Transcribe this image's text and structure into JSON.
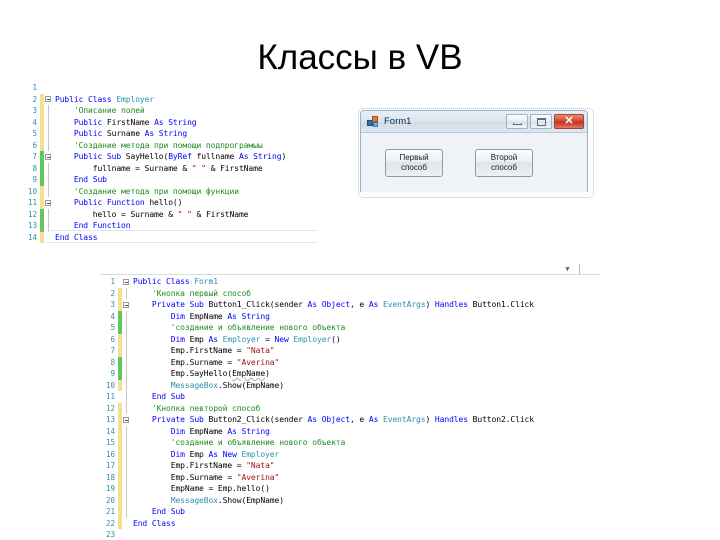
{
  "slide": {
    "title": "Классы в VB"
  },
  "code_panel_1": {
    "name": "Employer class code",
    "lines": [
      {
        "num": "1",
        "mark": "",
        "glyph": "",
        "indent": 0,
        "tokens": []
      },
      {
        "num": "2",
        "mark": "yellow",
        "glyph": "collapse",
        "indent": 0,
        "tokens": [
          {
            "t": "Public Class ",
            "c": "kw"
          },
          {
            "t": "Employer",
            "c": "typ"
          }
        ]
      },
      {
        "num": "3",
        "mark": "yellow",
        "glyph": "vbar",
        "indent": 4,
        "tokens": [
          {
            "t": "'Описание полей",
            "c": "cmt"
          }
        ]
      },
      {
        "num": "4",
        "mark": "yellow",
        "glyph": "vbar",
        "indent": 4,
        "tokens": [
          {
            "t": "Public ",
            "c": "kw"
          },
          {
            "t": "FirstName ",
            "c": "plain"
          },
          {
            "t": "As String",
            "c": "kw"
          }
        ]
      },
      {
        "num": "5",
        "mark": "yellow",
        "glyph": "vbar",
        "indent": 4,
        "tokens": [
          {
            "t": "Public ",
            "c": "kw"
          },
          {
            "t": "Surname ",
            "c": "plain"
          },
          {
            "t": "As String",
            "c": "kw"
          }
        ]
      },
      {
        "num": "6",
        "mark": "yellow",
        "glyph": "vbar",
        "indent": 4,
        "tokens": [
          {
            "t": "'Создание метода при помощи подпрограмыы",
            "c": "cmt"
          }
        ]
      },
      {
        "num": "7",
        "mark": "green",
        "glyph": "collapse",
        "indent": 4,
        "tokens": [
          {
            "t": "Public Sub ",
            "c": "kw"
          },
          {
            "t": "SayHello(",
            "c": "plain"
          },
          {
            "t": "ByRef ",
            "c": "kw"
          },
          {
            "t": "fullname ",
            "c": "plain"
          },
          {
            "t": "As String",
            "c": "kw"
          },
          {
            "t": ")",
            "c": "plain"
          }
        ]
      },
      {
        "num": "8",
        "mark": "green",
        "glyph": "vbar",
        "indent": 8,
        "tokens": [
          {
            "t": "fullname = Surname & ",
            "c": "plain"
          },
          {
            "t": "\" \"",
            "c": "str"
          },
          {
            "t": " & FirstName",
            "c": "plain"
          }
        ]
      },
      {
        "num": "9",
        "mark": "green",
        "glyph": "vbar",
        "indent": 4,
        "tokens": [
          {
            "t": "End Sub",
            "c": "kw"
          }
        ]
      },
      {
        "num": "10",
        "mark": "yellow",
        "glyph": "vbar",
        "indent": 4,
        "tokens": [
          {
            "t": "'Создание метода при помощи функции",
            "c": "cmt"
          }
        ]
      },
      {
        "num": "11",
        "mark": "yellow",
        "glyph": "collapse",
        "indent": 4,
        "tokens": [
          {
            "t": "Public Function ",
            "c": "kw"
          },
          {
            "t": "hello()",
            "c": "plain"
          }
        ]
      },
      {
        "num": "12",
        "mark": "green",
        "glyph": "vbar",
        "indent": 8,
        "tokens": [
          {
            "t": "hello = Surname & ",
            "c": "plain"
          },
          {
            "t": "\" \"",
            "c": "str"
          },
          {
            "t": " & FirstName",
            "c": "plain"
          }
        ]
      },
      {
        "num": "13",
        "mark": "green",
        "glyph": "vbar",
        "indent": 4,
        "tokens": [
          {
            "t": "End Function",
            "c": "kw"
          }
        ]
      },
      {
        "num": "14",
        "mark": "yellow",
        "glyph": "",
        "indent": 0,
        "tokens": [
          {
            "t": "End Class",
            "c": "kw"
          }
        ]
      }
    ]
  },
  "code_panel_2": {
    "name": "Form1 class code",
    "lines": [
      {
        "num": "1",
        "mark": "",
        "glyph": "collapse",
        "indent": 0,
        "tokens": [
          {
            "t": "Public Class ",
            "c": "kw"
          },
          {
            "t": "Form1",
            "c": "typ"
          }
        ]
      },
      {
        "num": "2",
        "mark": "yellow",
        "glyph": "vbar",
        "indent": 4,
        "tokens": [
          {
            "t": "'Кнопка первый способ",
            "c": "cmt"
          }
        ]
      },
      {
        "num": "3",
        "mark": "yellow",
        "glyph": "collapse",
        "indent": 4,
        "tokens": [
          {
            "t": "Private Sub ",
            "c": "kw"
          },
          {
            "t": "Button1_Click(sender ",
            "c": "plain"
          },
          {
            "t": "As ",
            "c": "kw"
          },
          {
            "t": "Object",
            "c": "kw"
          },
          {
            "t": ", e ",
            "c": "plain"
          },
          {
            "t": "As ",
            "c": "kw"
          },
          {
            "t": "EventArgs",
            "c": "typ"
          },
          {
            "t": ") ",
            "c": "plain"
          },
          {
            "t": "Handles ",
            "c": "kw"
          },
          {
            "t": "Button1.Click",
            "c": "plain"
          }
        ]
      },
      {
        "num": "4",
        "mark": "green",
        "glyph": "vbar",
        "indent": 8,
        "tokens": [
          {
            "t": "Dim ",
            "c": "kw"
          },
          {
            "t": "EmpName ",
            "c": "plain"
          },
          {
            "t": "As String",
            "c": "kw"
          }
        ]
      },
      {
        "num": "5",
        "mark": "green",
        "glyph": "vbar",
        "indent": 8,
        "tokens": [
          {
            "t": "'создание и объявление нового объекта",
            "c": "cmt"
          }
        ]
      },
      {
        "num": "6",
        "mark": "yellow",
        "glyph": "vbar",
        "indent": 8,
        "tokens": [
          {
            "t": "Dim ",
            "c": "kw"
          },
          {
            "t": "Emp ",
            "c": "plain"
          },
          {
            "t": "As ",
            "c": "kw"
          },
          {
            "t": "Employer ",
            "c": "typ"
          },
          {
            "t": "= ",
            "c": "plain"
          },
          {
            "t": "New ",
            "c": "kw"
          },
          {
            "t": "Employer",
            "c": "typ"
          },
          {
            "t": "()",
            "c": "plain"
          }
        ]
      },
      {
        "num": "7",
        "mark": "yellow",
        "glyph": "vbar",
        "indent": 8,
        "tokens": [
          {
            "t": "Emp.FirstName = ",
            "c": "plain"
          },
          {
            "t": "\"Nata\"",
            "c": "str"
          }
        ]
      },
      {
        "num": "8",
        "mark": "green",
        "glyph": "vbar",
        "indent": 8,
        "tokens": [
          {
            "t": "Emp.Surname = ",
            "c": "plain"
          },
          {
            "t": "\"Averina\"",
            "c": "str"
          }
        ]
      },
      {
        "num": "9",
        "mark": "green",
        "glyph": "vbar",
        "indent": 8,
        "tokens": [
          {
            "t": "Emp.SayHello(",
            "c": "plain"
          },
          {
            "t": "EmpName",
            "c": "sq"
          },
          {
            "t": ")",
            "c": "plain"
          }
        ]
      },
      {
        "num": "10",
        "mark": "yellow",
        "glyph": "vbar",
        "indent": 8,
        "tokens": [
          {
            "t": "MessageBox",
            "c": "typ"
          },
          {
            "t": ".Show(EmpName)",
            "c": "plain"
          }
        ]
      },
      {
        "num": "11",
        "mark": "",
        "glyph": "vbar",
        "indent": 4,
        "tokens": [
          {
            "t": "End Sub",
            "c": "kw"
          }
        ]
      },
      {
        "num": "12",
        "mark": "yellow",
        "glyph": "vbar",
        "indent": 4,
        "tokens": [
          {
            "t": "'Кнопка певторой способ",
            "c": "cmt"
          }
        ]
      },
      {
        "num": "13",
        "mark": "yellow",
        "glyph": "collapse",
        "indent": 4,
        "tokens": [
          {
            "t": "Private Sub ",
            "c": "kw"
          },
          {
            "t": "Button2_Click(sender ",
            "c": "plain"
          },
          {
            "t": "As ",
            "c": "kw"
          },
          {
            "t": "Object",
            "c": "kw"
          },
          {
            "t": ", e ",
            "c": "plain"
          },
          {
            "t": "As ",
            "c": "kw"
          },
          {
            "t": "EventArgs",
            "c": "typ"
          },
          {
            "t": ") ",
            "c": "plain"
          },
          {
            "t": "Handles ",
            "c": "kw"
          },
          {
            "t": "Button2.Click",
            "c": "plain"
          }
        ]
      },
      {
        "num": "14",
        "mark": "yellow",
        "glyph": "vbar",
        "indent": 8,
        "tokens": [
          {
            "t": "Dim ",
            "c": "kw"
          },
          {
            "t": "EmpName ",
            "c": "plain"
          },
          {
            "t": "As String",
            "c": "kw"
          }
        ]
      },
      {
        "num": "15",
        "mark": "yellow",
        "glyph": "vbar",
        "indent": 8,
        "tokens": [
          {
            "t": "'создание и объявление нового объекта",
            "c": "cmt"
          }
        ]
      },
      {
        "num": "16",
        "mark": "yellow",
        "glyph": "vbar",
        "indent": 8,
        "tokens": [
          {
            "t": "Dim ",
            "c": "kw"
          },
          {
            "t": "Emp ",
            "c": "plain"
          },
          {
            "t": "As New ",
            "c": "kw"
          },
          {
            "t": "Employer",
            "c": "typ"
          }
        ]
      },
      {
        "num": "17",
        "mark": "yellow",
        "glyph": "vbar",
        "indent": 8,
        "tokens": [
          {
            "t": "Emp.FirstName = ",
            "c": "plain"
          },
          {
            "t": "\"Nata\"",
            "c": "str"
          }
        ]
      },
      {
        "num": "18",
        "mark": "yellow",
        "glyph": "vbar",
        "indent": 8,
        "tokens": [
          {
            "t": "Emp.Surname = ",
            "c": "plain"
          },
          {
            "t": "\"Averina\"",
            "c": "str"
          }
        ]
      },
      {
        "num": "19",
        "mark": "yellow",
        "glyph": "vbar",
        "indent": 8,
        "tokens": [
          {
            "t": "EmpName = Emp.hello()",
            "c": "plain"
          }
        ]
      },
      {
        "num": "20",
        "mark": "yellow",
        "glyph": "vbar",
        "indent": 8,
        "tokens": [
          {
            "t": "MessageBox",
            "c": "typ"
          },
          {
            "t": ".Show(EmpName)",
            "c": "plain"
          }
        ]
      },
      {
        "num": "21",
        "mark": "yellow",
        "glyph": "vbar",
        "indent": 4,
        "tokens": [
          {
            "t": "End Sub",
            "c": "kw"
          }
        ]
      },
      {
        "num": "22",
        "mark": "yellow",
        "glyph": "",
        "indent": 0,
        "tokens": [
          {
            "t": "End Class",
            "c": "kw"
          }
        ]
      },
      {
        "num": "23",
        "mark": "",
        "glyph": "",
        "indent": 0,
        "tokens": []
      }
    ]
  },
  "form_window": {
    "title": "Form1",
    "icon": "vb-form-icon",
    "minimize_label": "",
    "maximize_label": "",
    "close_label": "✕",
    "buttons": [
      {
        "name": "button-first-method",
        "line1": "Первый",
        "line2": "способ"
      },
      {
        "name": "button-second-method",
        "line1": "Второй",
        "line2": "способ"
      }
    ]
  },
  "colors": {
    "keyword": "#0000ff",
    "type": "#2b91af",
    "comment": "#1f8b1f",
    "string": "#a31515",
    "line_number": "#2b91af",
    "mark_changed": "#f2e093",
    "mark_saved": "#62c462"
  }
}
